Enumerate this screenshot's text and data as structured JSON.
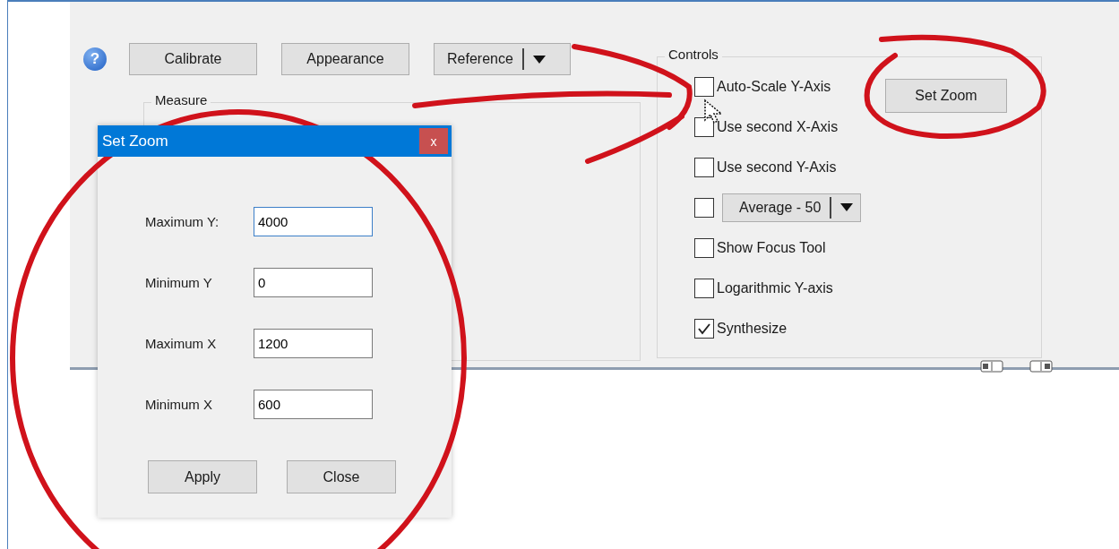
{
  "toolbar": {
    "help_glyph": "?",
    "buttons": [
      {
        "kind": "button",
        "label": "Calibrate"
      },
      {
        "kind": "button",
        "label": "Appearance"
      },
      {
        "kind": "split",
        "label": "Reference"
      }
    ]
  },
  "measure_group": {
    "title": "Measure"
  },
  "controls_group": {
    "title": "Controls",
    "set_zoom_button": "Set Zoom",
    "options": [
      {
        "kind": "checkbox",
        "label": "Auto-Scale Y-Axis",
        "checked": false
      },
      {
        "kind": "checkbox",
        "label": "Use second X-Axis",
        "checked": false
      },
      {
        "kind": "checkbox",
        "label": "Use second Y-Axis",
        "checked": false
      },
      {
        "kind": "checkbox_dropdown",
        "value": "Average - 50",
        "checked": false
      },
      {
        "kind": "checkbox",
        "label": "Show Focus Tool",
        "checked": false
      },
      {
        "kind": "checkbox",
        "label": "Logarithmic Y-axis",
        "checked": false
      },
      {
        "kind": "checkbox",
        "label": "Synthesize",
        "checked": true
      }
    ]
  },
  "dialog": {
    "title": "Set Zoom",
    "close_glyph": "x",
    "fields": [
      {
        "label": "Maximum Y:",
        "value": "4000",
        "focused": true
      },
      {
        "label": "Minimum Y",
        "value": "0",
        "focused": false
      },
      {
        "label": "Maximum X",
        "value": "1200",
        "focused": false
      },
      {
        "label": "Minimum X",
        "value": "600",
        "focused": false
      }
    ],
    "buttons": [
      "Apply",
      "Close"
    ]
  }
}
